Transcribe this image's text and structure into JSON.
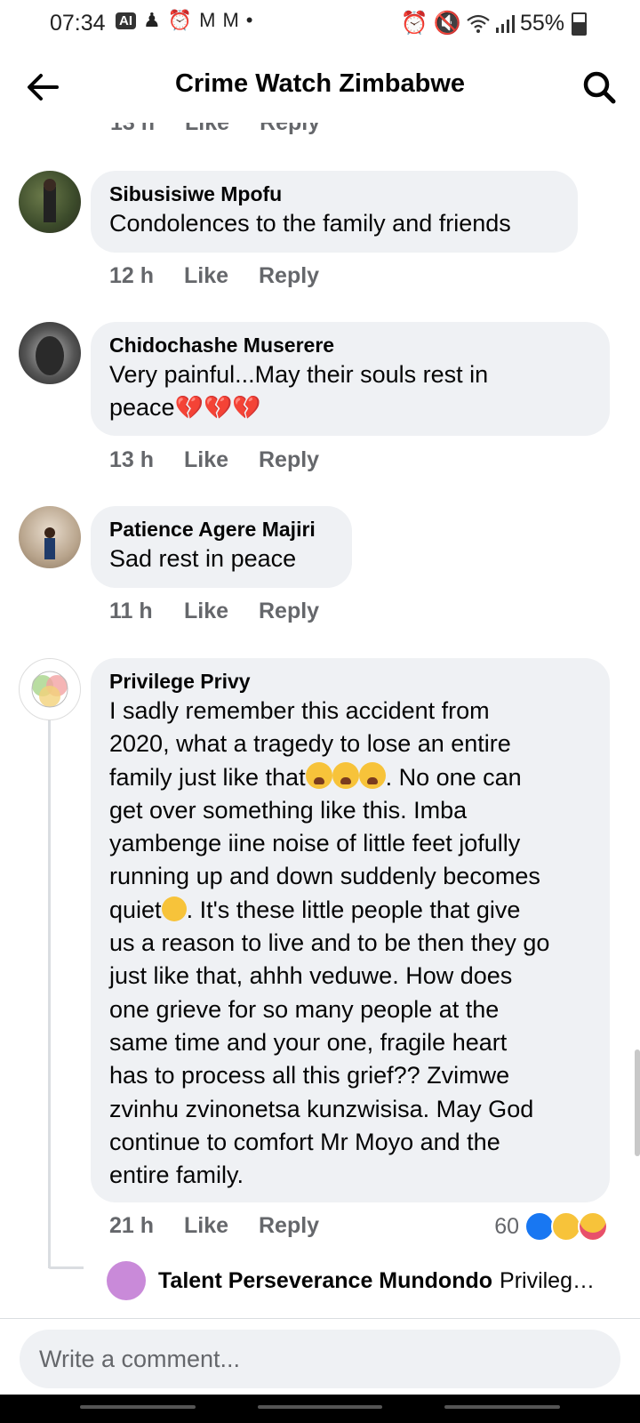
{
  "status_bar": {
    "time": "07:34",
    "ai_badge": "AI",
    "battery": "55%",
    "battery_level": 0.55
  },
  "header": {
    "title": "Crime Watch Zimbabwe",
    "back_icon": "arrow-left-icon",
    "search_icon": "search-icon"
  },
  "cut_actions": {
    "time": "13 h",
    "like": "Like",
    "reply": "Reply"
  },
  "comments": [
    {
      "author": "Sibusisiwe Mpofu",
      "text": "Condolences to the family and friends",
      "time": "12 h",
      "like": "Like",
      "reply": "Reply"
    },
    {
      "author": "Chidochashe Muserere",
      "text_line1": "Very painful...May their souls rest in",
      "text_line2": "peace",
      "emoji": "💔💔💔",
      "time": "13 h",
      "like": "Like",
      "reply": "Reply"
    },
    {
      "author": "Patience Agere Majiri",
      "text": "Sad rest in peace",
      "time": "11 h",
      "like": "Like",
      "reply": "Reply"
    },
    {
      "author": "Privilege Privy",
      "lines": [
        "I sadly remember this accident from",
        "2020, what a tragedy to lose an entire",
        "family just like that",
        ". No one can",
        "get over something like this. Imba",
        "yambenge iine noise of little feet jofully",
        "running up and down suddenly becomes",
        "quiet",
        ". It's these little people that give",
        "us a reason to live and to be then they go",
        "just like that, ahhh veduwe.  How does",
        "one grieve for so many people at the",
        "same time and your one, fragile heart",
        "has to process all this grief?? Zvimwe",
        "zvinhu zvinonetsa kunzwisisa. May God",
        "continue to comfort Mr Moyo and the",
        "entire family."
      ],
      "time": "21 h",
      "like": "Like",
      "reply": "Reply",
      "reaction_count": "60"
    }
  ],
  "reply_preview": {
    "author": "Talent Perseverance Mundondo",
    "text": "Privilege..."
  },
  "composer": {
    "placeholder": "Write a comment..."
  }
}
